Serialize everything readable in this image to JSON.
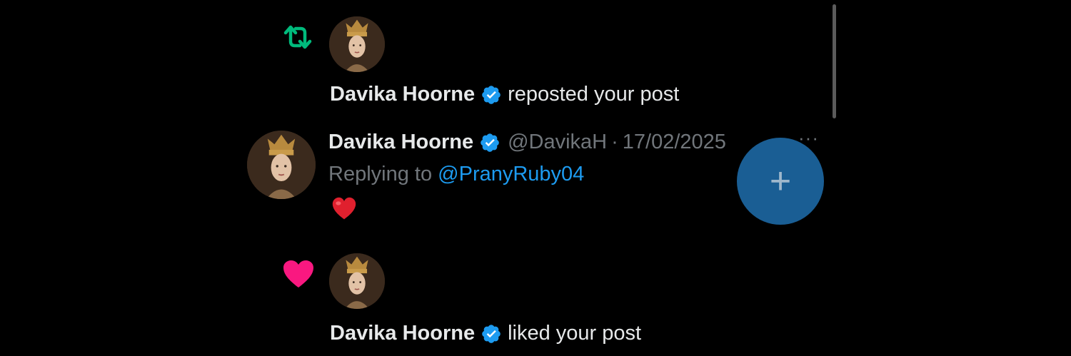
{
  "notifications": [
    {
      "type": "repost",
      "icon": "repost-icon",
      "icon_color": "#00ba7c",
      "user_name": "Davika Hoorne",
      "action_text": "reposted your post"
    },
    {
      "type": "reply",
      "user_name": "Davika Hoorne",
      "handle": "@DavikaH",
      "separator": "·",
      "date": "17/02/2025",
      "replying_prefix": "Replying to",
      "replying_to": "@PranyRuby04",
      "content": "❤️",
      "more_label": "···"
    },
    {
      "type": "like",
      "icon": "heart-icon",
      "icon_color": "#f91880",
      "user_name": "Davika Hoorne",
      "action_text": "liked your post"
    }
  ],
  "fab": {
    "label": "+",
    "color": "#1a5e94"
  },
  "colors": {
    "background": "#000000",
    "verified": "#1d9bf0",
    "mention": "#1d9bf0",
    "muted": "#71767b"
  }
}
